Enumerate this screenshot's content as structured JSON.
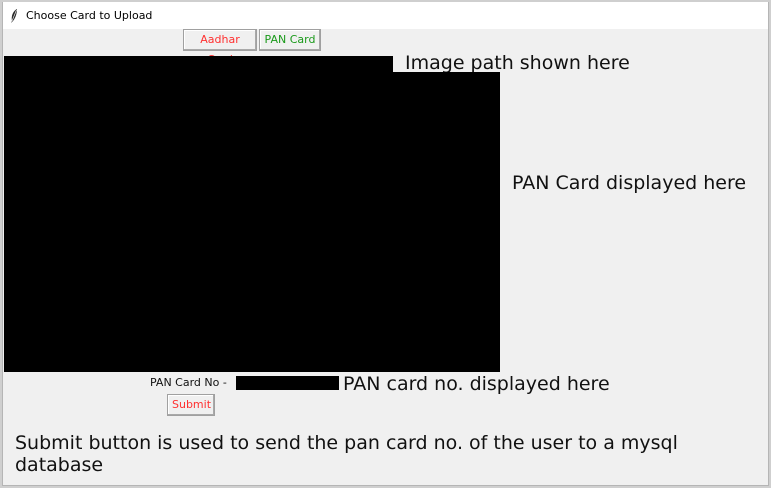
{
  "window": {
    "title": "Choose Card to Upload",
    "icon": "feather-icon"
  },
  "toolbar": {
    "aadhar_label": "Aadhar Card",
    "pan_label": "PAN Card",
    "aadhar_color": "#ff3030",
    "pan_color": "#1a9a1a"
  },
  "annotations": {
    "path_note": "Image path shown here",
    "image_note": "PAN Card displayed here",
    "pan_no_note": "PAN card no. displayed here",
    "submit_note": "Submit button is used to send the pan card no. of the user to a mysql database"
  },
  "form": {
    "pan_no_label": "PAN Card No -",
    "submit_label": "Submit"
  }
}
